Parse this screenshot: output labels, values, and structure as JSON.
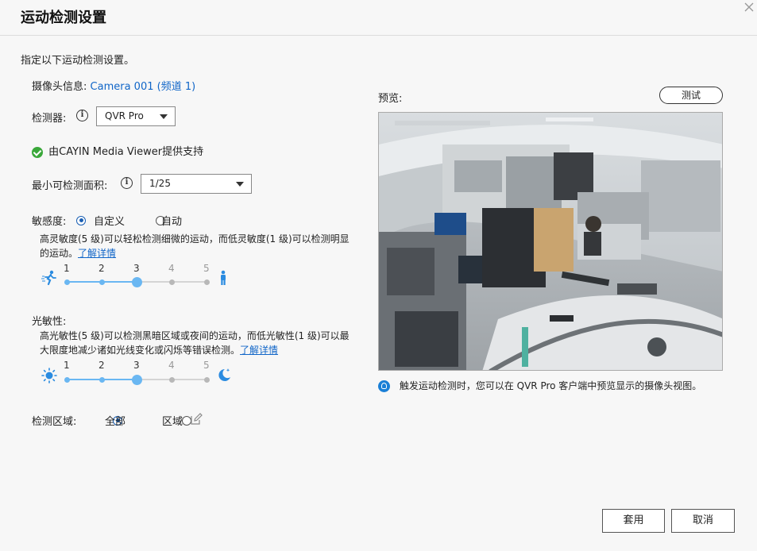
{
  "dialog": {
    "title": "运动检测设置",
    "intro": "指定以下运动检测设置。"
  },
  "camera": {
    "label": "摄像头信息:",
    "value": "Camera 001 (频道 1)"
  },
  "detector": {
    "label": "检测器:",
    "selected": "QVR Pro",
    "support_text": "由CAYIN Media Viewer提供支持"
  },
  "min_area": {
    "label": "最小可检测面积:",
    "selected": "1/25"
  },
  "sensitivity": {
    "label": "敏感度:",
    "option_custom": "自定义",
    "option_auto": "自动",
    "selected": "custom",
    "description": "高灵敏度(5 级)可以轻松检测细微的运动，而低灵敏度(1 级)可以检测明显的运动。",
    "learn_more": "了解详情",
    "levels": [
      "1",
      "2",
      "3",
      "4",
      "5"
    ],
    "value": 3
  },
  "light": {
    "label": "光敏性:",
    "description": "高光敏性(5 级)可以检测黑暗区域或夜间的运动，而低光敏性(1 级)可以最大限度地减少诸如光线变化或闪烁等错误检测。",
    "learn_more": "了解详情",
    "levels": [
      "1",
      "2",
      "3",
      "4",
      "5"
    ],
    "value": 3
  },
  "area": {
    "label": "检测区域:",
    "option_all": "全部",
    "option_region": "区域",
    "selected": "all"
  },
  "preview": {
    "label": "预览:",
    "test_button": "测试",
    "hint": "触发运动检测时，您可以在 QVR Pro 客户端中预览显示的摄像头视图。"
  },
  "footer": {
    "apply": "套用",
    "cancel": "取消"
  },
  "colors": {
    "accent": "#6ab7f2",
    "link": "#1166c8",
    "radio": "#1a5fb4",
    "success": "#3aa83a"
  }
}
